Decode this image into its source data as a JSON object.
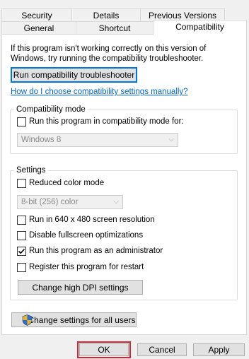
{
  "tabs": {
    "row1": [
      "Security",
      "Details",
      "Previous Versions"
    ],
    "row2": [
      "General",
      "Shortcut",
      "Compatibility"
    ]
  },
  "intro_text": "If this program isn't working correctly on this version of Windows, try running the compatibility troubleshooter.",
  "troubleshooter_button": "Run compatibility troubleshooter",
  "help_link": "How do I choose compatibility settings manually?",
  "compat_mode": {
    "group_label": "Compatibility mode",
    "checkbox_label": "Run this program in compatibility mode for:",
    "checked": false,
    "os_value": "Windows 8"
  },
  "settings": {
    "group_label": "Settings",
    "reduced_color": {
      "label": "Reduced color mode",
      "checked": false
    },
    "color_value": "8-bit (256) color",
    "res_640": {
      "label": "Run in 640 x 480 screen resolution",
      "checked": false
    },
    "fullscreen_opt": {
      "label": "Disable fullscreen optimizations",
      "checked": false
    },
    "run_admin": {
      "label": "Run this program as an administrator",
      "checked": true
    },
    "register_restart": {
      "label": "Register this program for restart",
      "checked": false
    },
    "dpi_button": "Change high DPI settings"
  },
  "all_users_button": "Change settings for all users",
  "footer": {
    "ok": "OK",
    "cancel": "Cancel",
    "apply": "Apply"
  },
  "colors": {
    "link": "#0066cc",
    "focus": "#0078d7",
    "highlight": "#d9232d"
  }
}
